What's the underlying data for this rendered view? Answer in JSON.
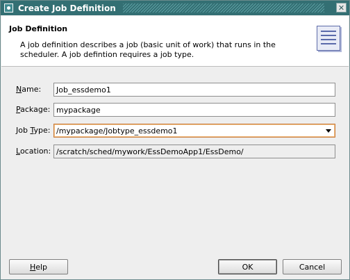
{
  "window": {
    "title": "Create Job Definition",
    "close_glyph": "✕"
  },
  "header": {
    "title": "Job Definition",
    "description": "A job definition describes a job (basic unit of work) that runs in the scheduler.  A job defintion requires a job type.",
    "icon": "document-list-icon"
  },
  "form": {
    "name": {
      "label_mnemonic": "N",
      "label_rest": "ame:",
      "value": "Job_essdemo1"
    },
    "package": {
      "label_mnemonic": "P",
      "label_rest": "ackage:",
      "value": "mypackage"
    },
    "job_type": {
      "label_pre": "Job ",
      "label_mnemonic": "T",
      "label_rest": "ype:",
      "value": "/mypackage/Jobtype_essdemo1"
    },
    "location": {
      "label_mnemonic": "L",
      "label_rest": "ocation:",
      "value": "/scratch/sched/mywork/EssDemoApp1/EssDemo/"
    }
  },
  "buttons": {
    "help": {
      "mnemonic": "H",
      "rest": "elp"
    },
    "ok": "OK",
    "cancel": "Cancel"
  },
  "colors": {
    "titlebar": "#336f73",
    "focus_border": "#c87a3a"
  }
}
